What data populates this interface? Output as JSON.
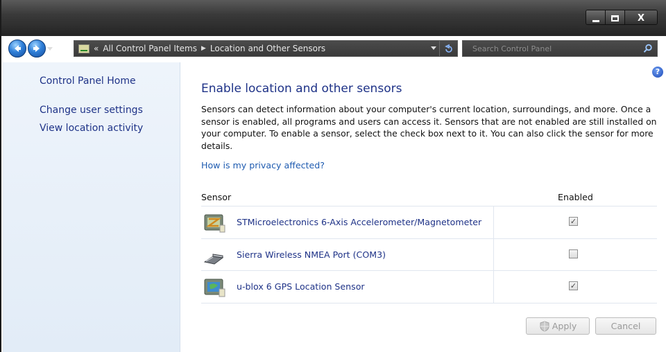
{
  "window": {
    "minimize_glyph": "minimize-icon",
    "maximize_glyph": "maximize-icon",
    "close_label": "X"
  },
  "navigation": {
    "back_icon": "back-arrow-icon",
    "forward_icon": "forward-arrow-icon",
    "overflow": "«",
    "breadcrumb": [
      "All Control Panel Items",
      "Location and Other Sensors"
    ],
    "separator": "▶",
    "refresh_icon": "refresh-icon",
    "search_placeholder": "Search Control Panel"
  },
  "left_pane": {
    "home": "Control Panel Home",
    "links": [
      "Change user settings",
      "View location activity"
    ]
  },
  "main": {
    "help_label": "?",
    "title": "Enable location and other sensors",
    "description": "Sensors can detect information about your computer's current location, surroundings, and more. Once a sensor is enabled, all programs and users can access it. Sensors that are not enabled are still installed on your computer. To enable a sensor, select the check box next to it. You can also click the sensor for more details.",
    "privacy_link": "How is my privacy affected?",
    "table": {
      "headers": [
        "Sensor",
        "Enabled"
      ],
      "rows": [
        {
          "name": "STMicroelectronics 6-Axis Accelerometer/Magnetometer",
          "enabled": true,
          "check": "✓",
          "icon": "accelerometer-sensor-icon"
        },
        {
          "name": "Sierra Wireless NMEA Port (COM3)",
          "enabled": false,
          "check": "",
          "icon": "modem-port-icon"
        },
        {
          "name": "u-blox 6 GPS Location Sensor",
          "enabled": true,
          "check": "✓",
          "icon": "gps-sensor-icon"
        }
      ]
    },
    "apply_label": "Apply",
    "cancel_label": "Cancel"
  },
  "colors": {
    "link": "#1e3287",
    "left_pane_bg": "#e2ecf7",
    "titlebar": "#2a2a2a"
  }
}
